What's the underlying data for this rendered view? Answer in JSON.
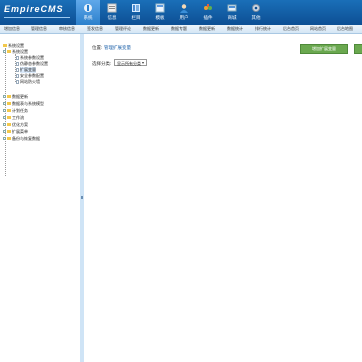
{
  "app": {
    "logo": "EmpireCMS"
  },
  "topnav": [
    {
      "label": "系统",
      "icon": "system-icon",
      "active": true
    },
    {
      "label": "信息",
      "icon": "info-icon"
    },
    {
      "label": "栏目",
      "icon": "column-icon"
    },
    {
      "label": "模板",
      "icon": "template-icon"
    },
    {
      "label": "用户",
      "icon": "user-icon"
    },
    {
      "label": "插件",
      "icon": "plugin-icon"
    },
    {
      "label": "商城",
      "icon": "shop-icon"
    },
    {
      "label": "其他",
      "icon": "other-icon"
    }
  ],
  "tabs": [
    "增加信息",
    "管理信息",
    "审核信息",
    "签发信息",
    "管理评论",
    "数据更新",
    "数据专题",
    "数据更新",
    "数据统计",
    "排行统计",
    "后台首页",
    "网站首页",
    "后台地图"
  ],
  "tree": {
    "root": "系统设置",
    "system_settings": "系统设置",
    "children": [
      "系统参数设置",
      "伪静态参数设置",
      "扩展变量",
      "安全参数配置",
      "网站防火墙"
    ],
    "others": [
      "数据更新",
      "数据表与系统模型",
      "计划任务",
      "工作流",
      "优化方案",
      "扩展菜单",
      "备份与恢复数据"
    ]
  },
  "main": {
    "breadcrumb_prefix": "位置:",
    "breadcrumb_link": "管理扩展变量",
    "add_button": "增加扩展变量",
    "filter_label": "选择分类:",
    "filter_value": "显示所有分类"
  }
}
